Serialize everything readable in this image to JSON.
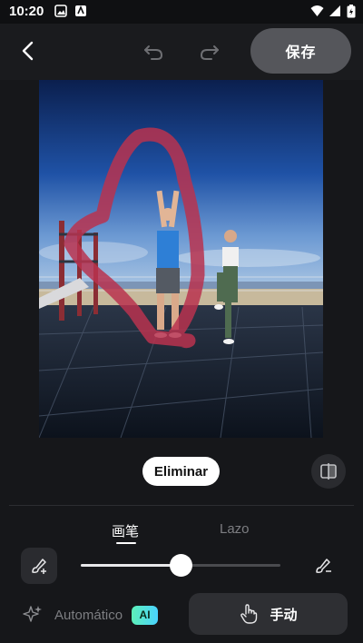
{
  "status_bar": {
    "time": "10:20"
  },
  "header": {
    "save_label": "保存"
  },
  "photo": {
    "stroke_color": "#b8334f"
  },
  "actions": {
    "mode_pill": "Eliminar"
  },
  "tabs": [
    {
      "label": "画笔",
      "active": true
    },
    {
      "label": "Lazo",
      "active": false
    }
  ],
  "brush": {
    "size_value": 0.5
  },
  "footer": {
    "auto_label": "Automático",
    "ai_badge": "AI",
    "manual_label": "手动"
  },
  "colors": {
    "background": "#16171a",
    "surface": "#2a2b2f",
    "accent_ai_start": "#5df0b8",
    "accent_ai_end": "#4ad3ff"
  }
}
